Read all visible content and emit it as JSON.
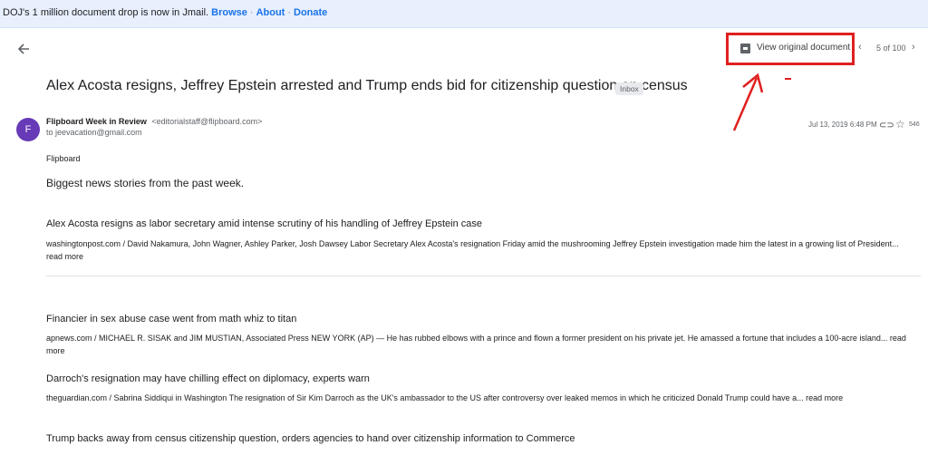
{
  "banner": {
    "message": "DOJ's 1 million document drop is now in Jmail.",
    "links": [
      "Browse",
      "About",
      "Donate"
    ]
  },
  "toolbar": {
    "original_label": "View original document",
    "counter": "5 of 100"
  },
  "email": {
    "subject": "Alex Acosta resigns, Jeffrey Epstein arrested and Trump ends bid for citizenship question on census",
    "label": "Inbox",
    "avatar_letter": "F",
    "sender_name": "Flipboard Week in Review",
    "sender_email": "<editorialstaff@flipboard.com>",
    "to": "to jeevacation@gmail.com",
    "date": "Jul 13, 2019 6:48 PM",
    "star_count": "546",
    "intro": "Flipboard",
    "headline": "Biggest news stories from the past week.",
    "stories": [
      {
        "title": "Alex Acosta resigns as labor secretary amid intense scrutiny of his handling of Jeffrey Epstein case",
        "text": "washingtonpost.com / David Nakamura, John Wagner, Ashley Parker, Josh Dawsey Labor Secretary Alex Acosta's resignation Friday amid the mushrooming Jeffrey Epstein investigation made him the latest in a growing list of President... read more"
      },
      {
        "title": "Financier in sex abuse case went from math whiz to titan",
        "text": "apnews.com / MICHAEL R. SISAK and JIM MUSTIAN, Associated Press NEW YORK (AP) — He has rubbed elbows with a prince and flown a former president on his private jet. He amassed a fortune that includes a 100-acre island... read more"
      },
      {
        "title": "Darroch's resignation may have chilling effect on diplomacy, experts warn",
        "text": "theguardian.com / Sabrina Siddiqui in Washington The resignation of Sir Kim Darroch as the UK's ambassador to the US after controversy over leaked memos in which he criticized Donald Trump could have a... read more"
      },
      {
        "title": "Trump backs away from census citizenship question, orders agencies to hand over citizenship information to Commerce",
        "text": ""
      }
    ]
  },
  "colors": {
    "accent": "#1a73e8",
    "annotation": "#e02020",
    "avatar": "#673ab7"
  }
}
